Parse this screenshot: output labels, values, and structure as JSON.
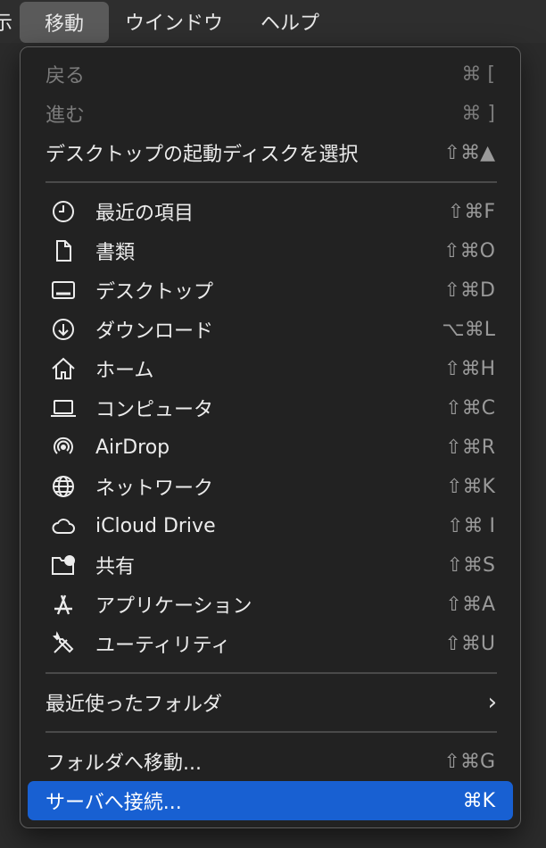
{
  "menubar": {
    "clipped": "示",
    "active": "移動",
    "window": "ウインドウ",
    "help": "ヘルプ"
  },
  "menu": {
    "back": {
      "label": "戻る",
      "shortcut": "⌘ ["
    },
    "forward": {
      "label": "進む",
      "shortcut": "⌘ ]"
    },
    "startup": {
      "label": "デスクトップの起動ディスクを選択",
      "shortcut": "⇧⌘▲"
    },
    "places": [
      {
        "label": "最近の項目",
        "shortcut": "⇧⌘F",
        "icon": "clock-icon"
      },
      {
        "label": "書類",
        "shortcut": "⇧⌘O",
        "icon": "document-icon"
      },
      {
        "label": "デスクトップ",
        "shortcut": "⇧⌘D",
        "icon": "desktop-icon"
      },
      {
        "label": "ダウンロード",
        "shortcut": "⌥⌘L",
        "icon": "download-icon"
      },
      {
        "label": "ホーム",
        "shortcut": "⇧⌘H",
        "icon": "home-icon"
      },
      {
        "label": "コンピュータ",
        "shortcut": "⇧⌘C",
        "icon": "laptop-icon"
      },
      {
        "label": "AirDrop",
        "shortcut": "⇧⌘R",
        "icon": "airdrop-icon"
      },
      {
        "label": "ネットワーク",
        "shortcut": "⇧⌘K",
        "icon": "globe-icon"
      },
      {
        "label": "iCloud Drive",
        "shortcut": "⇧⌘ I",
        "icon": "cloud-icon"
      },
      {
        "label": "共有",
        "shortcut": "⇧⌘S",
        "icon": "shared-folder-icon"
      },
      {
        "label": "アプリケーション",
        "shortcut": "⇧⌘A",
        "icon": "applications-icon"
      },
      {
        "label": "ユーティリティ",
        "shortcut": "⇧⌘U",
        "icon": "utilities-icon"
      }
    ],
    "recent_folders": {
      "label": "最近使ったフォルダ",
      "chevron": "›"
    },
    "goto_folder": {
      "label": "フォルダへ移動...",
      "shortcut": "⇧⌘G"
    },
    "connect_server": {
      "label": "サーバへ接続...",
      "shortcut": "⌘K"
    }
  },
  "colors": {
    "highlight": "#1860d2",
    "menu_bg": "#222222"
  }
}
